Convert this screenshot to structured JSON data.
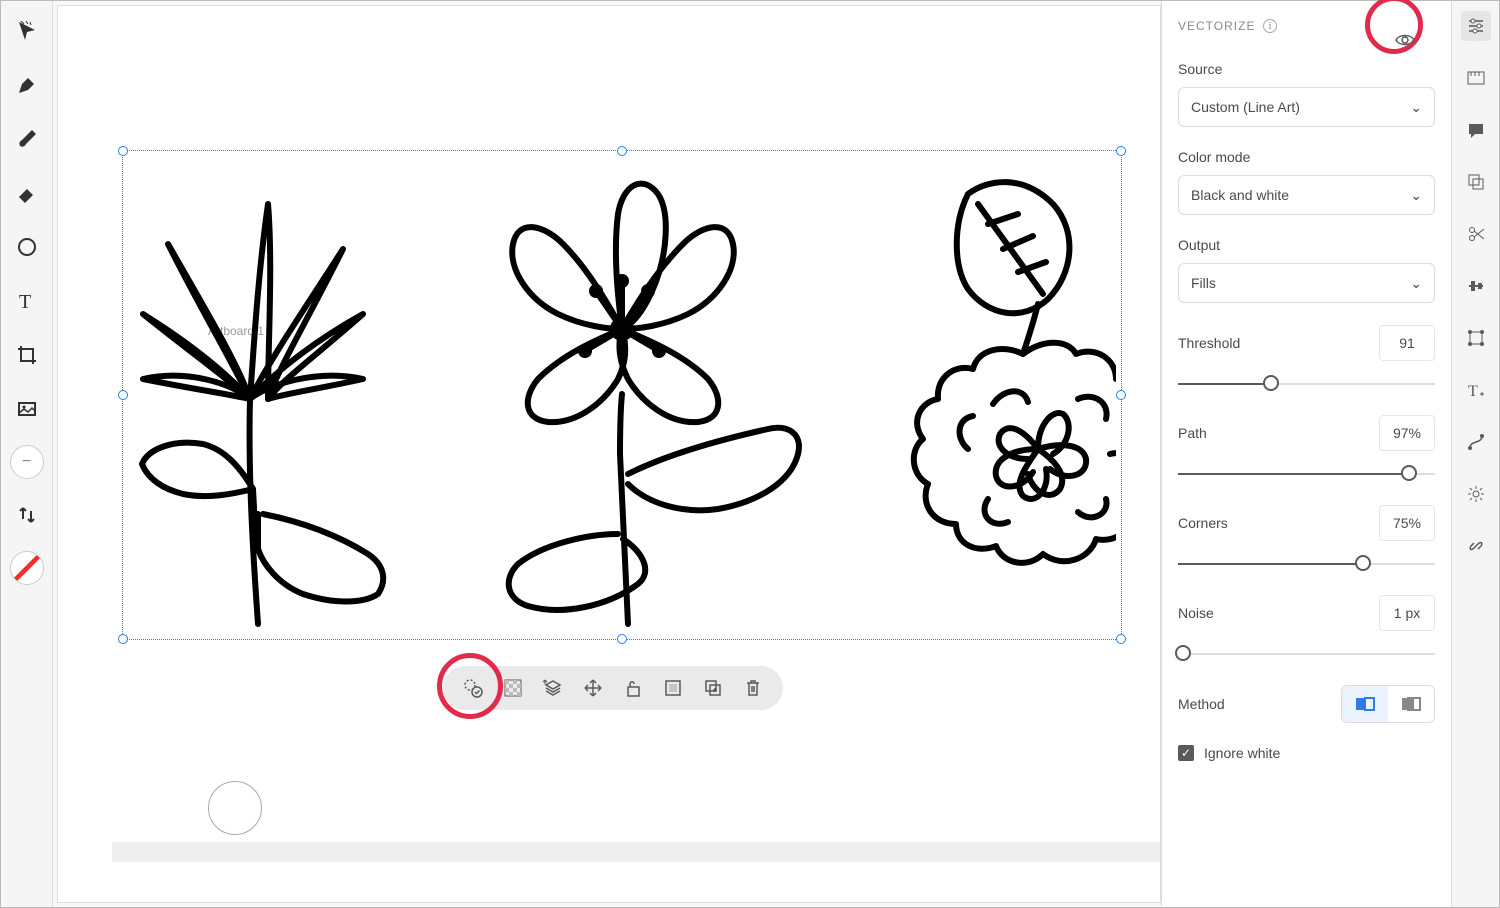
{
  "panel": {
    "title": "VECTORIZE",
    "source": {
      "label": "Source",
      "value": "Custom (Line Art)"
    },
    "color_mode": {
      "label": "Color mode",
      "value": "Black and white"
    },
    "output": {
      "label": "Output",
      "value": "Fills"
    },
    "threshold": {
      "label": "Threshold",
      "value": "91",
      "pct": 36
    },
    "path": {
      "label": "Path",
      "value": "97%",
      "pct": 90
    },
    "corners": {
      "label": "Corners",
      "value": "75%",
      "pct": 72
    },
    "noise": {
      "label": "Noise",
      "value": "1 px",
      "pct": 2
    },
    "method": {
      "label": "Method"
    },
    "ignore_white": {
      "label": "Ignore white",
      "checked": true
    }
  },
  "artboard_label": "Artboard 1"
}
